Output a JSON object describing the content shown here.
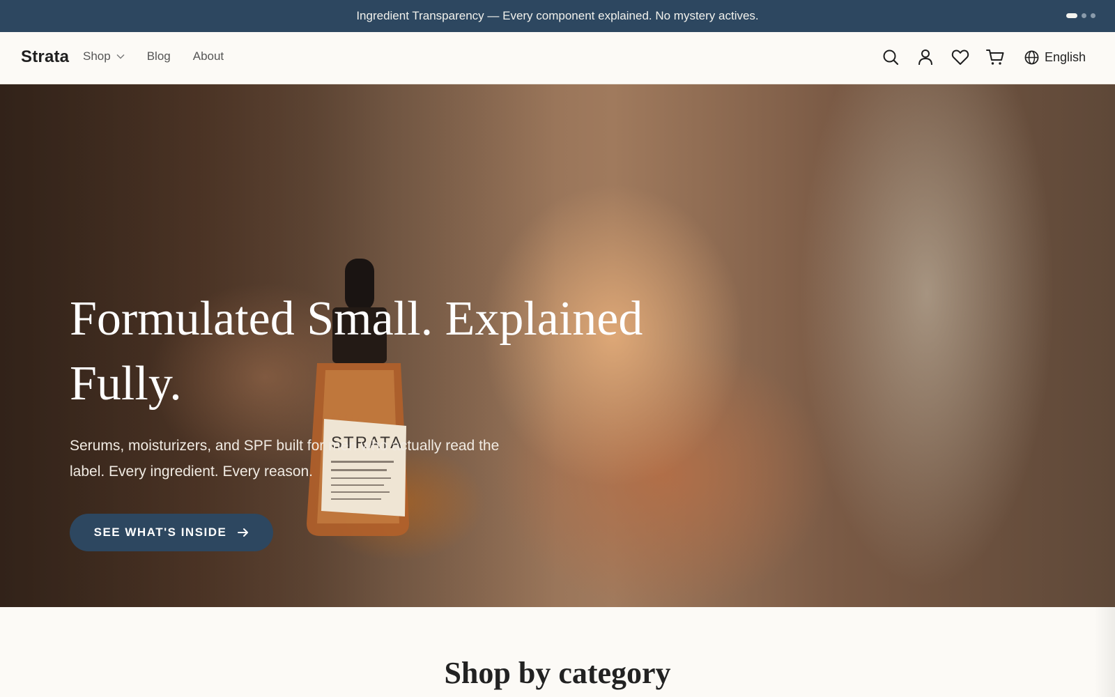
{
  "announcement": {
    "text": "Ingredient Transparency — Every component explained. No mystery actives.",
    "slides": 3,
    "active_slide": 1
  },
  "nav": {
    "brand": "Strata",
    "links": [
      {
        "label": "Shop",
        "has_dropdown": true
      },
      {
        "label": "Blog"
      },
      {
        "label": "About"
      }
    ],
    "icons": [
      "search-icon",
      "account-icon",
      "heart-icon",
      "cart-icon"
    ],
    "language": "English"
  },
  "hero": {
    "title": "Formulated Small. Explained Fully.",
    "subtitle": "Serums, moisturizers, and SPF built for men who actually read the label. Every ingredient. Every reason.",
    "cta_label": "SEE WHAT'S INSIDE",
    "bottle_label": "STRATA"
  },
  "section": {
    "title": "Shop by category"
  },
  "colors": {
    "accent": "#2d4760",
    "background": "#fcfaf6"
  }
}
